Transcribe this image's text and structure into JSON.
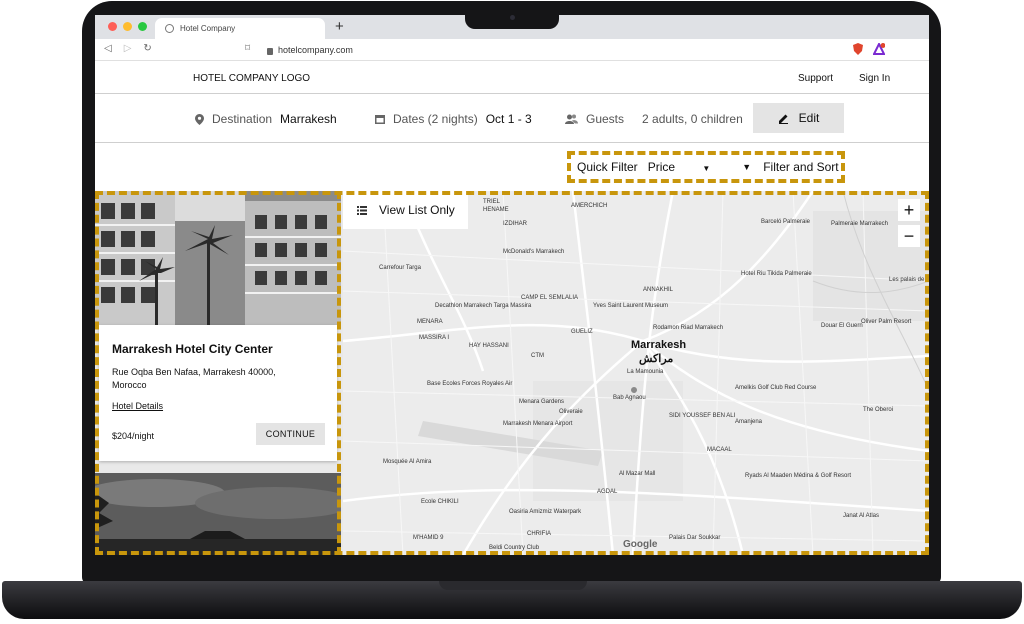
{
  "browser": {
    "tab_title": "Hotel Company",
    "new_tab": "+",
    "url": "hotelcompany.com"
  },
  "header": {
    "logo": "HOTEL COMPANY LOGO",
    "support": "Support",
    "sign_in": "Sign In"
  },
  "search": {
    "destination_label": "Destination",
    "destination_value": "Marrakesh",
    "dates_label": "Dates (2 nights)",
    "dates_value": "Oct 1 - 3",
    "guests_label": "Guests",
    "guests_value": "2 adults, 0 children",
    "edit_label": "Edit"
  },
  "filters": {
    "quick_filter_label": "Quick Filter",
    "quick_filter_value": "Price",
    "filter_sort_label": "Filter and Sort"
  },
  "results": [
    {
      "name": "Marrakesh Hotel City Center",
      "address": "Rue Oqba Ben Nafaa, Marrakesh 40000, Morocco",
      "details_link": "Hotel Details",
      "price": "$204/night",
      "action": "CONTINUE"
    }
  ],
  "map": {
    "view_list_label": "View List Only",
    "zoom_in": "+",
    "zoom_out": "−",
    "city": "Marrakesh",
    "city_arabic": "مراكش",
    "attribution": "Google",
    "labels": [
      "TRIEL",
      "HENAME",
      "AMERCHICH",
      "IZDIHAR",
      "McDonald's Marrakech",
      "Carrefour Targa",
      "Decathlon Marrakech Targa Massira",
      "CAMP EL SEMLALIA",
      "Yves Saint Laurent Museum",
      "ANNAKHIL",
      "MENARA",
      "MASSIRA I",
      "GUELIZ",
      "Rodamon Riad Marrakech",
      "HAY HASSANI",
      "CTM",
      "La Mamounia",
      "Base Ecoles Forces Royales Air",
      "Bab Agnaou",
      "Menara Gardens",
      "Oliveraie",
      "SIDI YOUSSEF BEN ALI",
      "Marrakesh Menara Airport",
      "Mosquée Al Amira",
      "Al Mazar Mall",
      "Ecole CHIKILI",
      "AGDAL",
      "Oasiria Amizmiz Waterpark",
      "M'HAMID 9",
      "CHRIFIA",
      "Beldi Country Club",
      "Palais Dar Soukkar",
      "Barceló Palmeraie",
      "Palmeraie Marrakech",
      "Hotel Riu Tikida Palmeraie",
      "Les palais de",
      "Oliver Palm Resort",
      "Douar El Guern",
      "Amelkis Golf Club Red Course",
      "Amanjena",
      "The Oberoi",
      "MACAAL",
      "Ryads Al Maaden Médina & Golf Resort",
      "Janat Al Atlas"
    ]
  },
  "colors": {
    "accent_dash": "#c8960c",
    "button_bg": "#e4e4e4",
    "map_bg": "#ececec"
  }
}
